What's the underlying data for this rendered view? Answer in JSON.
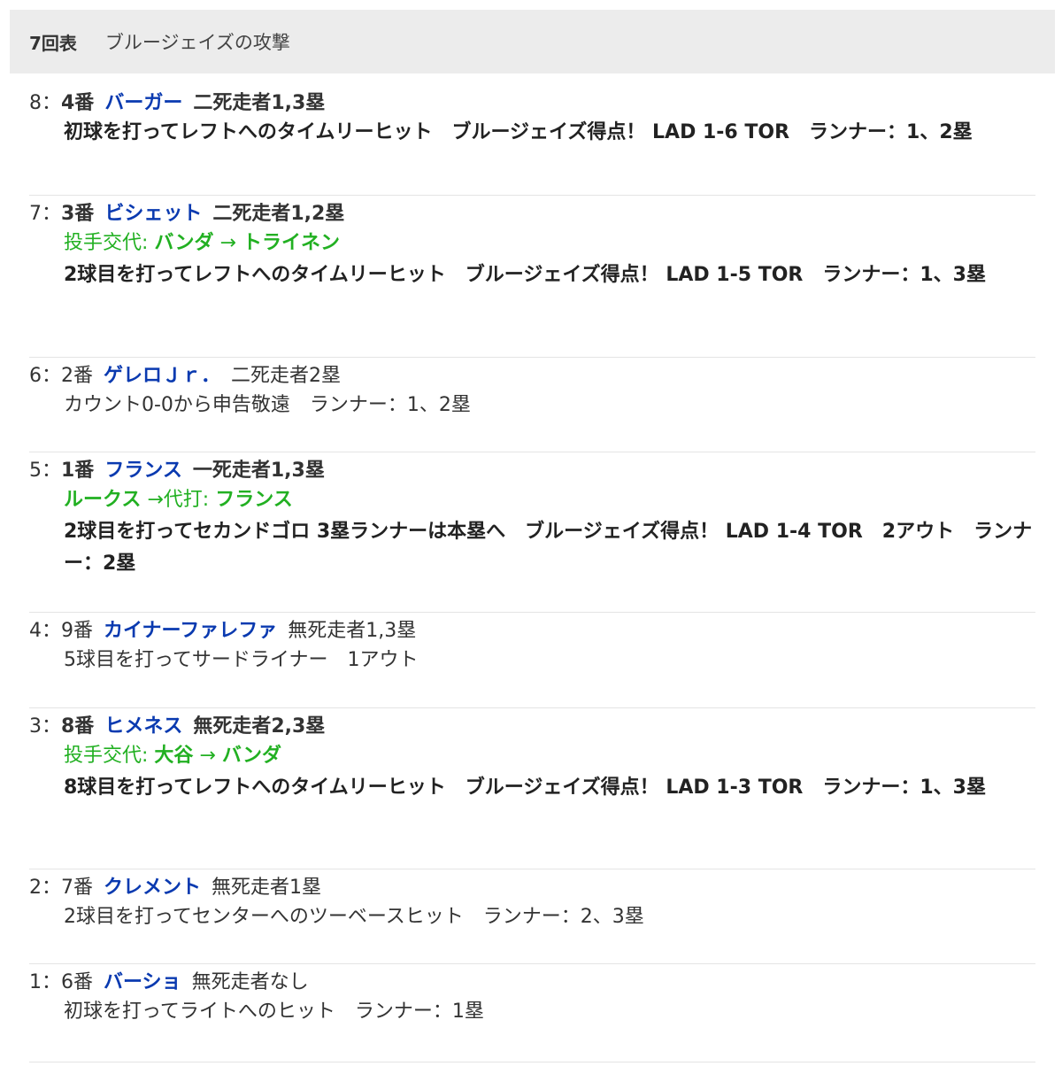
{
  "header": {
    "inning": "7回表",
    "title": "ブルージェイズの攻撃"
  },
  "plays": [
    {
      "num": "8：",
      "order": "4番",
      "player": "バーガー",
      "situation": "二死走者1,3塁",
      "description": "初球を打ってレフトへのタイムリーヒット　ブルージェイズ得点！ LAD 1-6 TOR　ランナー：1、2塁",
      "scoring": true
    },
    {
      "num": "7：",
      "order": "3番",
      "player": "ビシェット",
      "situation": "二死走者1,2塁",
      "sub": {
        "prefix": "投手交代: ",
        "from": "バンダ",
        "arrow": " → ",
        "to": "トライネン"
      },
      "description": "2球目を打ってレフトへのタイムリーヒット　ブルージェイズ得点！ LAD 1-5 TOR　ランナー：1、3塁",
      "scoring": true
    },
    {
      "num": "6：",
      "order": "2番",
      "player": "ゲレロＪｒ．",
      "situation": "二死走者2塁",
      "description": "カウント0-0から申告敬遠　ランナー：1、2塁",
      "scoring": false
    },
    {
      "num": "5：",
      "order": "1番",
      "player": "フランス",
      "situation": "一死走者1,3塁",
      "sub": {
        "prefix": "",
        "from": "ルークス",
        "arrow": " →代打: ",
        "to": "フランス"
      },
      "description": "2球目を打ってセカンドゴロ 3塁ランナーは本塁へ　ブルージェイズ得点！ LAD 1-4 TOR　2アウト　ランナー：2塁",
      "scoring": true
    },
    {
      "num": "4：",
      "order": "9番",
      "player": "カイナーファレファ",
      "situation": "無死走者1,3塁",
      "description": "5球目を打ってサードライナー　1アウト",
      "scoring": false
    },
    {
      "num": "3：",
      "order": "8番",
      "player": "ヒメネス",
      "situation": "無死走者2,3塁",
      "sub": {
        "prefix": "投手交代: ",
        "from": "大谷",
        "arrow": " → ",
        "to": "バンダ"
      },
      "description": "8球目を打ってレフトへのタイムリーヒット　ブルージェイズ得点！ LAD 1-3 TOR　ランナー：1、3塁",
      "scoring": true
    },
    {
      "num": "2：",
      "order": "7番",
      "player": "クレメント",
      "situation": "無死走者1塁",
      "description": "2球目を打ってセンターへのツーベースヒット　ランナー：2、3塁",
      "scoring": false
    },
    {
      "num": "1：",
      "order": "6番",
      "player": "バーショ",
      "situation": "無死走者なし",
      "description": "初球を打ってライトへのヒット　ランナー：1塁",
      "scoring": false
    }
  ],
  "colors": {
    "player": "#0a3ab0",
    "substitution": "#22b022",
    "header_bg": "#ececec"
  }
}
